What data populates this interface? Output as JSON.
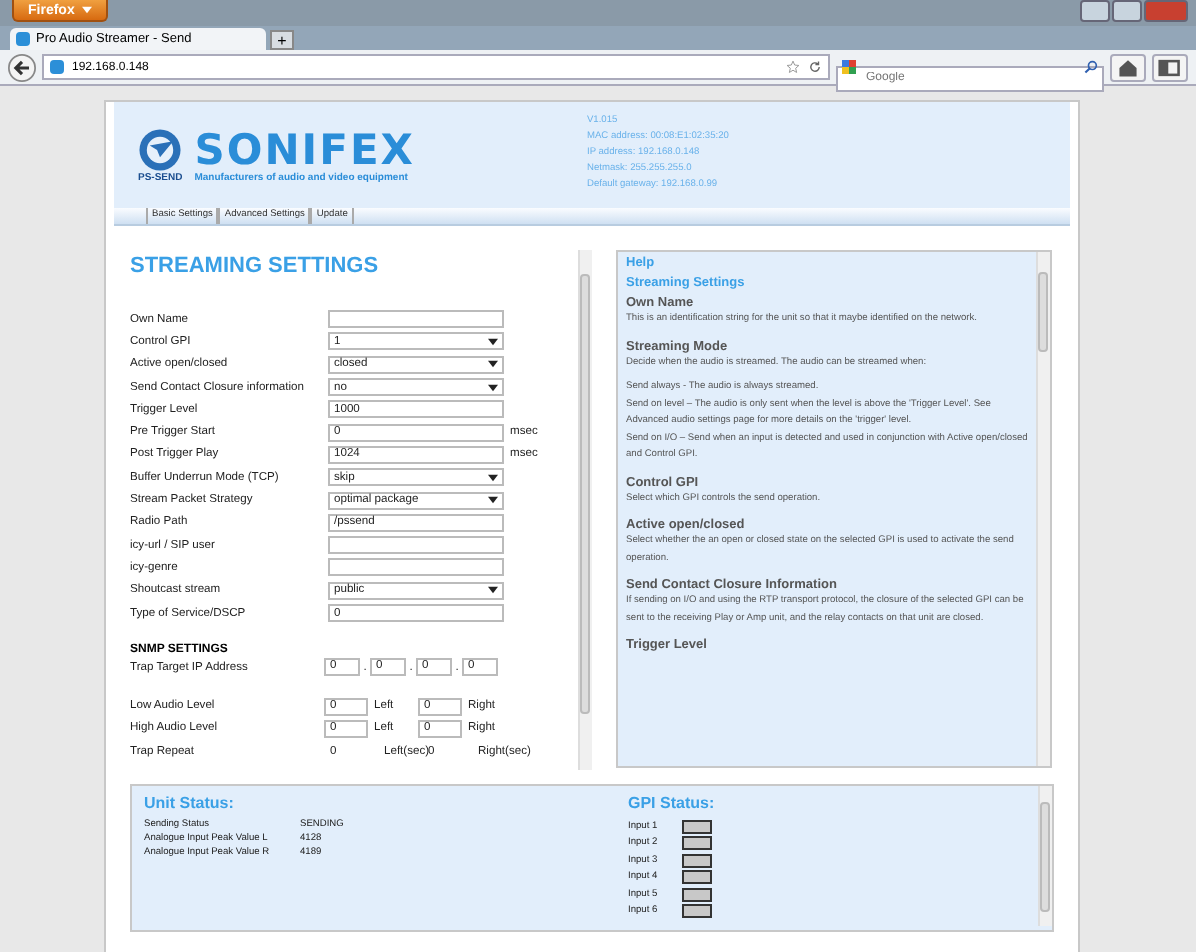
{
  "browser": {
    "menu_button": "Firefox",
    "tab": {
      "title": "Pro Audio Streamer - Send"
    },
    "new_tab": "+",
    "address": "192.168.0.148",
    "search_placeholder": "Google"
  },
  "header": {
    "badge": "PS-SEND",
    "brand": "SONIFEX",
    "tagline": "Manufacturers of audio and video equipment",
    "info": [
      "V1.015",
      "MAC address: 00:08:E1:02:35:20",
      "IP address: 192.168.0.148",
      "Netmask: 255.255.255.0",
      "Default gateway: 192.168.0.99"
    ]
  },
  "nav": [
    "Basic Settings",
    "Advanced Settings",
    "Update"
  ],
  "settings": {
    "title": "STREAMING SETTINGS",
    "fields": [
      {
        "kind": "text",
        "label": "Own Name"
      },
      {
        "kind": "select",
        "label": "Control GPI",
        "value": "1"
      },
      {
        "kind": "select",
        "label": "Active open/closed",
        "value": "closed"
      },
      {
        "kind": "select",
        "label": "Send Contact Closure information",
        "value": "no"
      },
      {
        "kind": "text",
        "label": "Trigger Level",
        "value": "1000"
      },
      {
        "kind": "text",
        "label": "Pre Trigger Start",
        "value": "0",
        "unit": "msec"
      },
      {
        "kind": "text",
        "label": "Post Trigger Play",
        "value": "1024",
        "unit": "msec"
      },
      {
        "kind": "select",
        "label": "Buffer Underrun Mode (TCP)",
        "value": "skip"
      },
      {
        "kind": "select",
        "label": "Stream Packet Strategy",
        "value": "optimal package"
      },
      {
        "kind": "text",
        "label": "Radio Path",
        "value": "/pssend"
      },
      {
        "kind": "text",
        "label": "icy-url / SIP user"
      },
      {
        "kind": "text",
        "label": "icy-genre"
      },
      {
        "kind": "select",
        "label": "Shoutcast stream",
        "value": "public"
      },
      {
        "kind": "text",
        "label": "Type of Service/DSCP",
        "value": "0"
      }
    ],
    "snmp": {
      "title": "SNMP SETTINGS",
      "ip_label": "Trap Target IP Address",
      "ip": [
        "0",
        "0",
        "0",
        "0"
      ],
      "ip_separator": ".",
      "rows": [
        {
          "kind": "field",
          "label": "Low Audio Level",
          "value_1": "0",
          "unit_1": "Left",
          "value_2": "0",
          "unit_2": "Right"
        },
        {
          "kind": "field",
          "label": "High Audio Level",
          "value_1": "0",
          "unit_1": "Left",
          "value_2": "0",
          "unit_2": "Right"
        },
        {
          "kind": "plain",
          "label": "Trap Repeat",
          "value_1": "0",
          "unit_1": "Left(sec)",
          "value_2": "0",
          "unit_2": "Right(sec)"
        }
      ]
    }
  },
  "help": {
    "title": "Help",
    "subtitle": "Streaming Settings",
    "sections": [
      {
        "heading": "Own Name",
        "paragraphs": [
          "This is an identification string for the unit so that it maybe identified on the network."
        ]
      },
      {
        "heading": "Streaming Mode",
        "paragraphs": [
          "Decide when the audio is streamed. The audio can be streamed when:",
          "Send always - The audio is always streamed.\nSend on level – The audio is only sent when the level is above the 'Trigger Level'. See Advanced audio settings page for more details on the 'trigger' level.\nSend on I/O – Send when an input is detected and used in conjunction with Active open/closed and Control GPI."
        ]
      },
      {
        "heading": "Control GPI",
        "paragraphs": [
          "Select which GPI controls the send operation."
        ]
      },
      {
        "heading": "Active open/closed",
        "paragraphs": [
          "Select whether the an open or closed state on the selected GPI is used to activate the send operation."
        ]
      },
      {
        "heading": "Send Contact Closure Information",
        "paragraphs": [
          "If sending on I/O and using the RTP transport protocol, the closure of the selected GPI can be sent to the receiving Play or Amp unit, and the relay contacts on that unit are closed."
        ]
      },
      {
        "heading": "Trigger Level"
      }
    ]
  },
  "unit_status": {
    "title": "Unit Status:",
    "rows": [
      {
        "label": "Sending Status",
        "value": "SENDING"
      },
      {
        "label": "Analogue Input Peak Value L",
        "value": "4128"
      },
      {
        "label": "Analogue Input Peak Value R",
        "value": "4189"
      }
    ]
  },
  "gpi_status": {
    "title": "GPI Status:",
    "inputs": [
      "Input 1",
      "Input 2",
      "Input 3",
      "Input 4",
      "Input 5",
      "Input 6"
    ]
  }
}
